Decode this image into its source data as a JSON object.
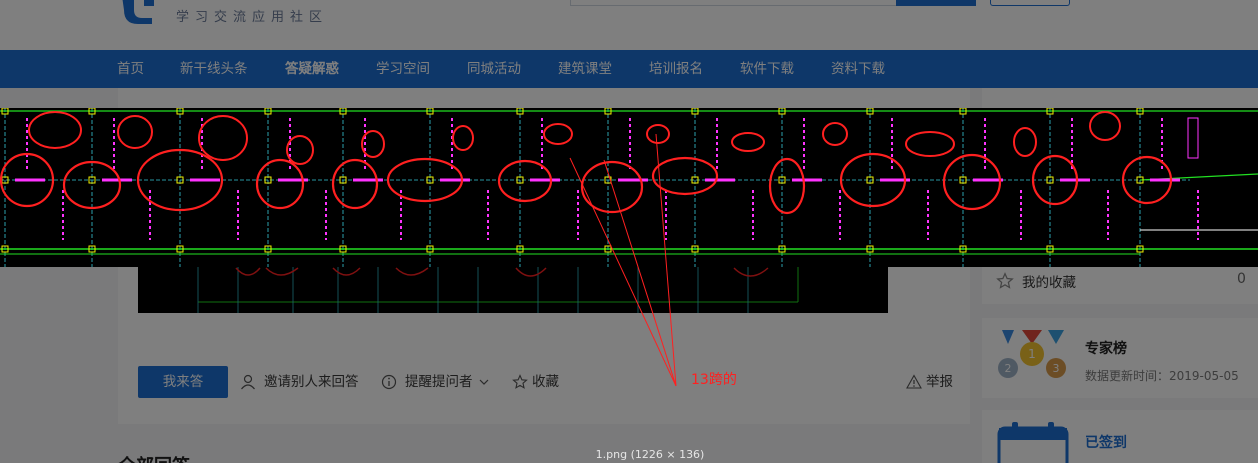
{
  "site": {
    "slogan": "学习交流应用社区"
  },
  "nav": {
    "items": [
      "首页",
      "新干线头条",
      "答疑解惑",
      "学习空间",
      "同城活动",
      "建筑课堂",
      "培训报名",
      "软件下载",
      "资料下载"
    ],
    "active_index": 2
  },
  "question_actions": {
    "answer_button": "我来答",
    "invite": "邀请别人来回答",
    "remind": "提醒提问者",
    "collect": "收藏",
    "report": "举报"
  },
  "section": {
    "all_answers_title": "全部回答"
  },
  "sidebar": {
    "favorites_label": "我的收藏",
    "favorites_count": "0",
    "expert_title": "专家榜",
    "expert_update_time": "数据更新时间：2019-05-05",
    "signed_label": "已签到",
    "medal_numbers": [
      "2",
      "1",
      "3"
    ]
  },
  "viewer": {
    "annotation_text": "13跨的",
    "caption": "1.png (1226 × 136)"
  },
  "colors": {
    "brand_blue": "#1d6fd3",
    "annotation_red": "#ff2020",
    "cad_magenta": "#ff33ff",
    "cad_green": "#22e022",
    "cad_yellow": "#f0f000",
    "cad_cyan": "#36c8d8"
  }
}
